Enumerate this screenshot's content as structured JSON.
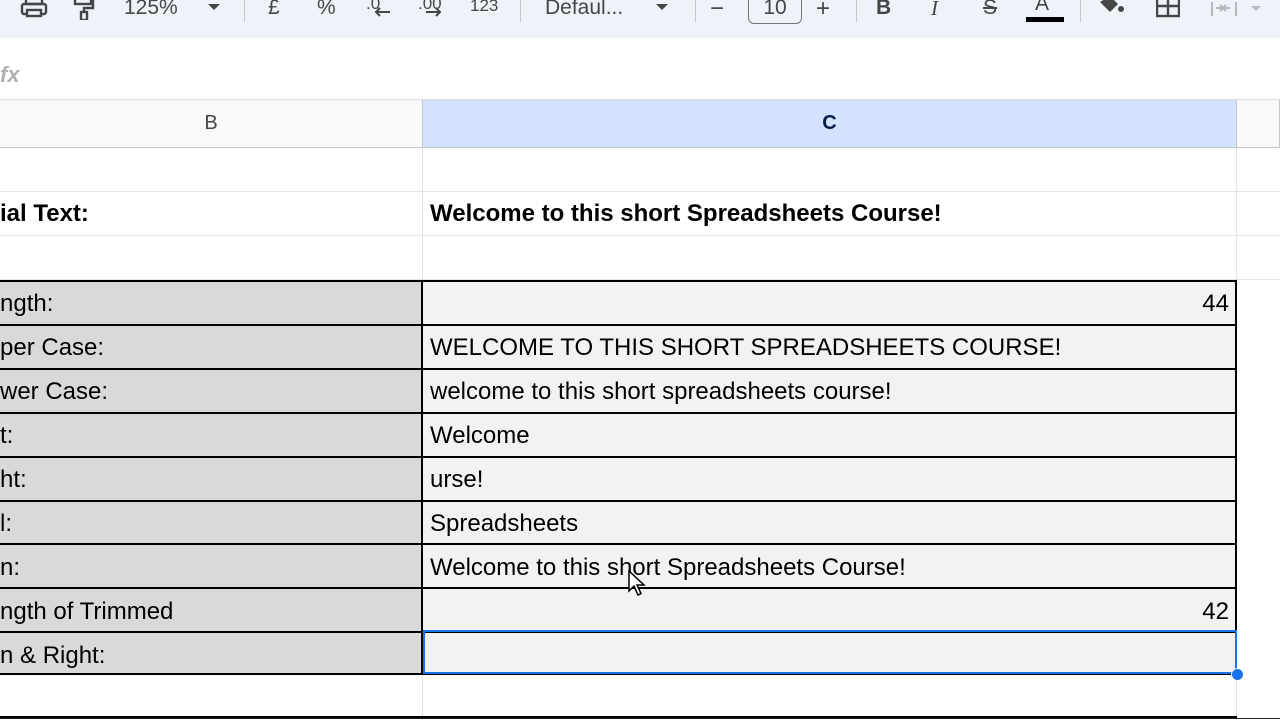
{
  "toolbar": {
    "zoom": "125%",
    "currency": "£",
    "percent": "%",
    "decrease_decimals": ".0",
    "increase_decimals": ".00",
    "number_format": "123",
    "font": "Defaul...",
    "font_size": "10",
    "decrease_size": "−",
    "increase_size": "+",
    "bold": "B",
    "italic": "I",
    "strike": "S",
    "text_color": "A"
  },
  "formula_bar": {
    "fx": "fx"
  },
  "columns": {
    "b": "B",
    "c": "C"
  },
  "rows": {
    "initial_label": "ial Text:",
    "initial_value": "Welcome to this short Spreadsheets Course!",
    "length_label": "ngth:",
    "length_value": "44",
    "upper_label": "per Case:",
    "upper_value": "WELCOME TO THIS SHORT SPREADSHEETS COURSE!",
    "lower_label": "wer Case:",
    "lower_value": "welcome to this short spreadsheets course!",
    "left_label": "t:",
    "left_value": "Welcome",
    "right_label": "ht:",
    "right_value": "urse!",
    "mid_label": "l:",
    "mid_value": "Spreadsheets",
    "trim_label": "n:",
    "trim_value": "Welcome to this short Spreadsheets Course!",
    "trim_length_label": "ngth of Trimmed",
    "trim_length_value": "42",
    "trim_lr_label": "n & Right:",
    "trim_lr_value": ""
  },
  "colors": {
    "selected_header": "#d3e3fd",
    "selection": "#1a73e8",
    "label_fill": "#d9d9d9",
    "value_fill": "#f2f2f2"
  }
}
